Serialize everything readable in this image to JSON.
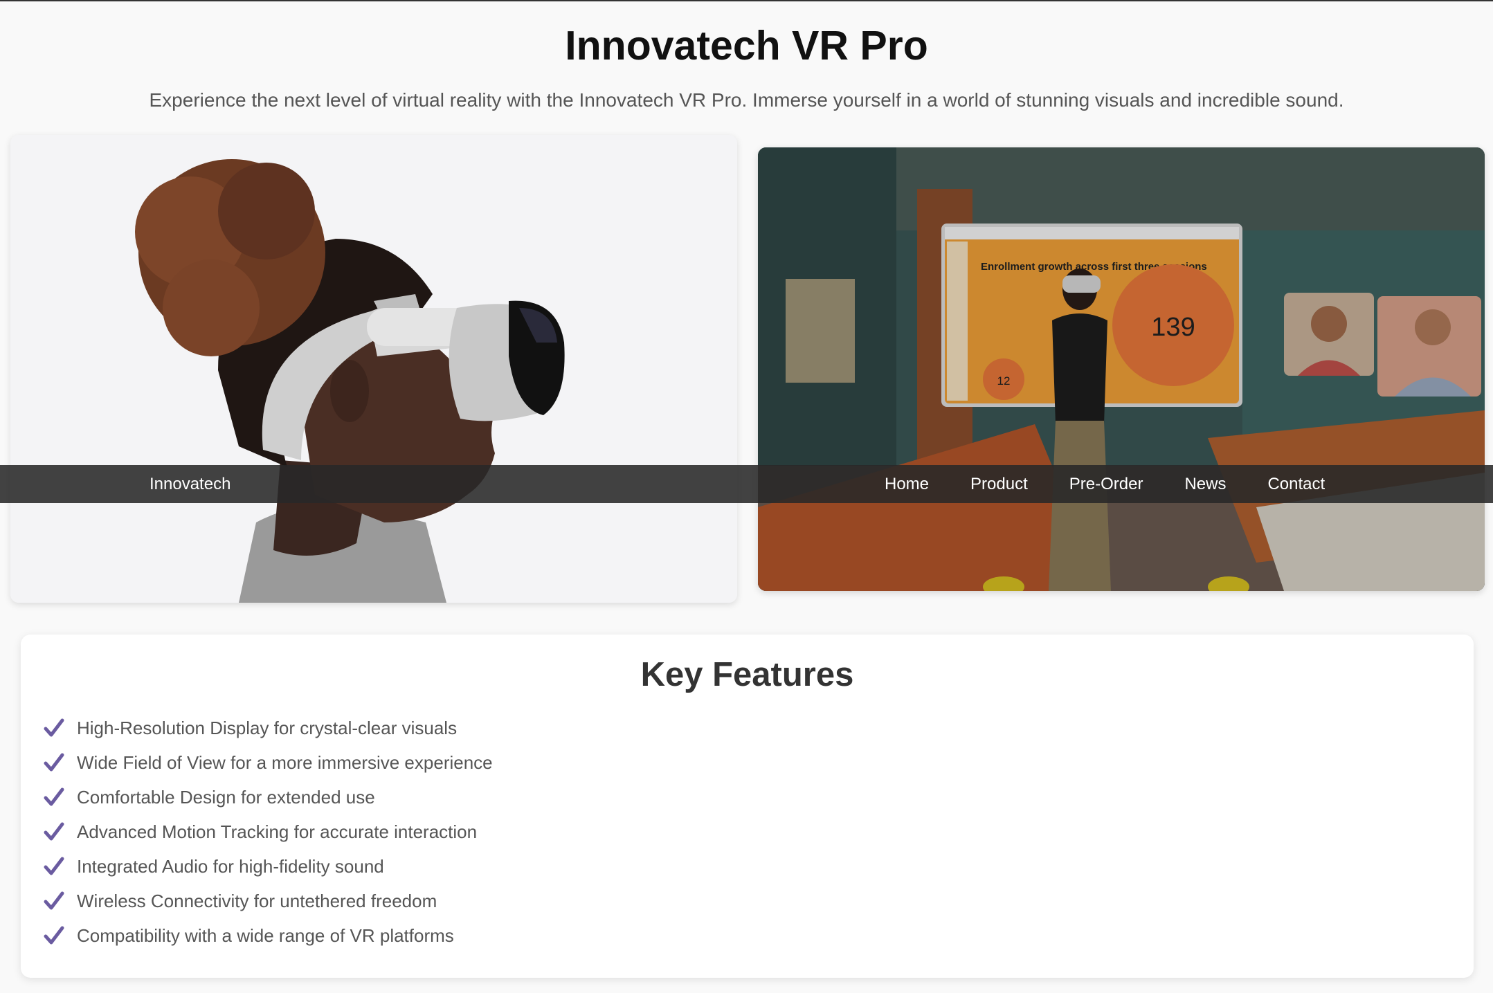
{
  "header": {
    "title": "Innovatech VR Pro",
    "subtitle": "Experience the next level of virtual reality with the Innovatech VR Pro. Immerse yourself in a world of stunning visuals and incredible sound."
  },
  "navbar": {
    "brand": "Innovatech",
    "links": [
      "Home",
      "Product",
      "Pre-Order",
      "News",
      "Contact"
    ]
  },
  "hero_right": {
    "screen_heading": "Enrollment growth across first three sessions",
    "big_number": "139",
    "small_number": "12"
  },
  "features": {
    "title": "Key Features",
    "items": [
      "High-Resolution Display for crystal-clear visuals",
      "Wide Field of View for a more immersive experience",
      "Comfortable Design for extended use",
      "Advanced Motion Tracking for accurate interaction",
      "Integrated Audio for high-fidelity sound",
      "Wireless Connectivity for untethered freedom",
      "Compatibility with a wide range of VR platforms"
    ]
  },
  "colors": {
    "check": "#6a5ba0",
    "navbar": "#282828",
    "screen_orange": "#f0a038",
    "circle_orange": "#e8773a"
  }
}
